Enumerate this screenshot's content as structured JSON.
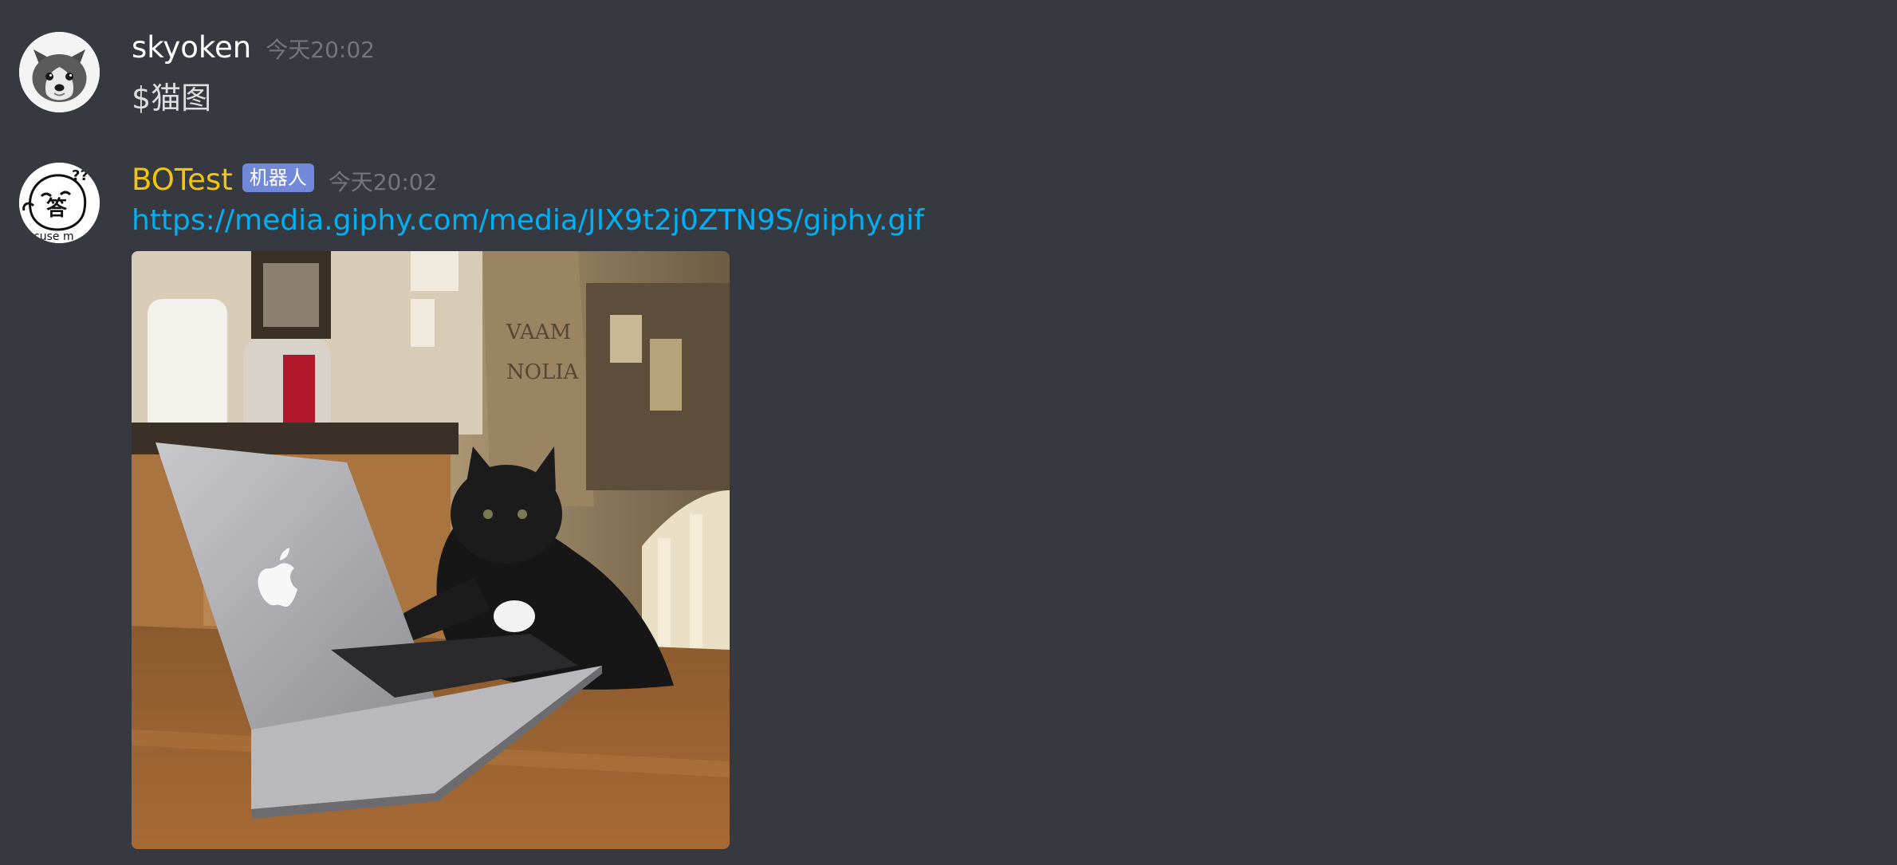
{
  "messages": [
    {
      "author": "skyoken",
      "timestamp": "今天20:02",
      "content": "$猫图",
      "avatar_icon": "husky-dog-avatar-icon"
    },
    {
      "author": "BOTest",
      "author_color": "#f1c40f",
      "bot_tag": "机器人",
      "timestamp": "今天20:02",
      "link": "https://media.giphy.com/media/JIX9t2j0ZTN9S/giphy.gif",
      "avatar_icon": "meme-face-avatar-icon",
      "avatar_caption": "xcuse m",
      "embed_image": "cat-typing-on-laptop-gif"
    }
  ],
  "colors": {
    "background": "#36393f",
    "username": "#ffffff",
    "bot_username": "#f1c40f",
    "bot_tag": "#7289da",
    "timestamp": "#72767d",
    "link": "#00b0f4"
  }
}
